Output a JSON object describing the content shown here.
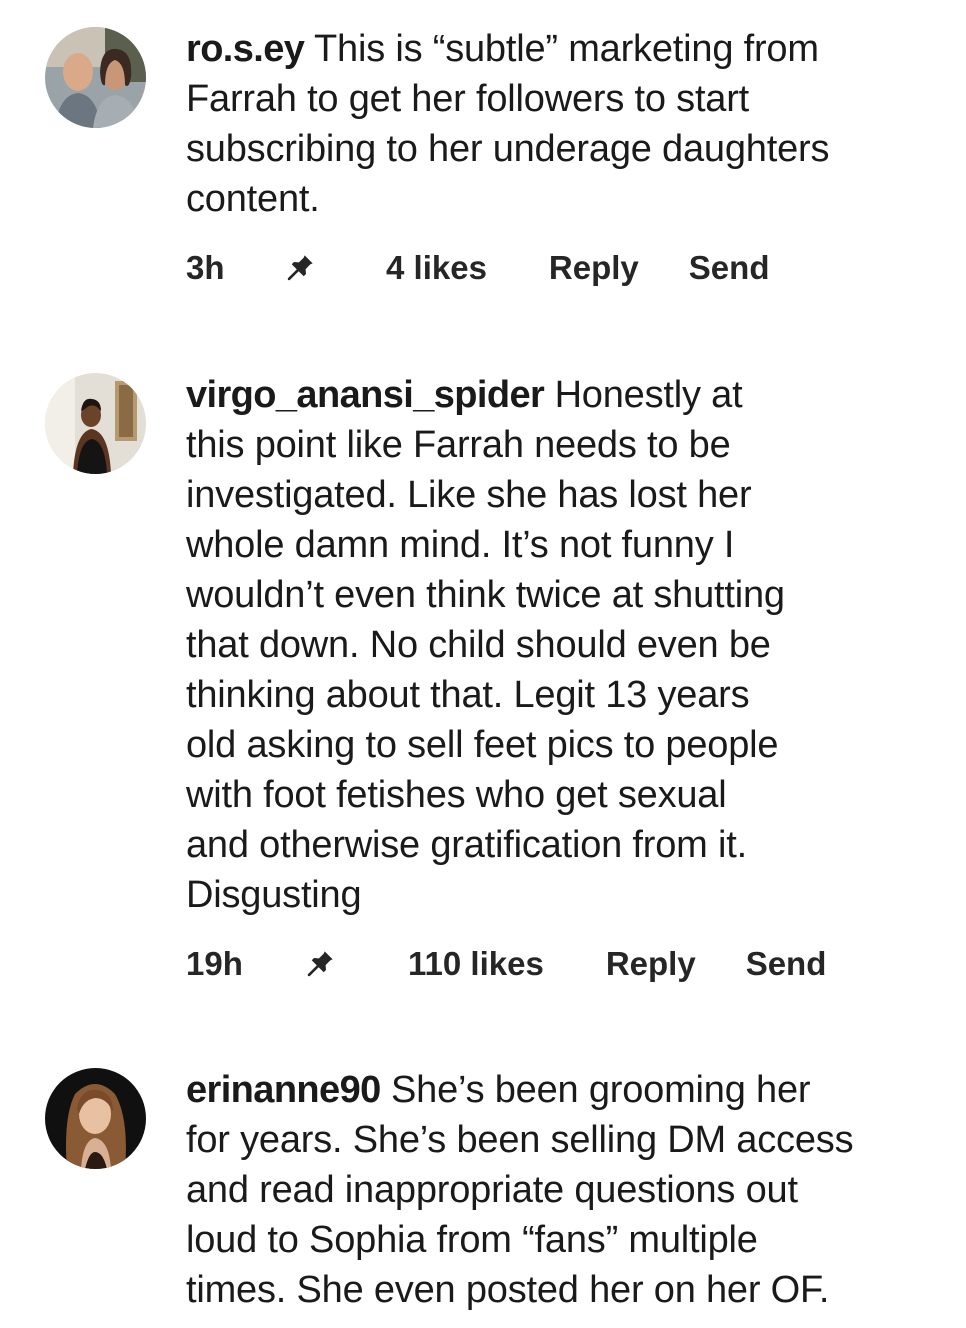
{
  "comments": [
    {
      "username": "ro.s.ey",
      "lines": [
        "This is “subtle” marketing from",
        "Farrah to get her followers to start",
        "subscribing to her underage daughters",
        "content."
      ],
      "time": "3h",
      "pin_icon": "pin-icon",
      "likes": "4 likes",
      "reply": "Reply",
      "send": "Send"
    },
    {
      "username": "virgo_anansi_spider",
      "lines": [
        "Honestly at",
        "this point like Farrah needs to be",
        "investigated. Like she has lost her",
        "whole damn mind. It’s not funny I",
        "wouldn’t even think twice at shutting",
        "that down. No child should even be",
        "thinking about that. Legit 13 years",
        "old asking to sell feet pics to people",
        "with foot fetishes who get sexual",
        "and otherwise gratification from it.",
        "Disgusting"
      ],
      "time": "19h",
      "pin_icon": "pin-icon",
      "likes": "110 likes",
      "reply": "Reply",
      "send": "Send"
    },
    {
      "username": "erinanne90",
      "lines": [
        "She’s been grooming her",
        "for years. She’s been selling DM access",
        "and read inappropriate questions out",
        "loud to Sophia from “fans” multiple",
        "times. She even posted her on her OF."
      ]
    }
  ]
}
